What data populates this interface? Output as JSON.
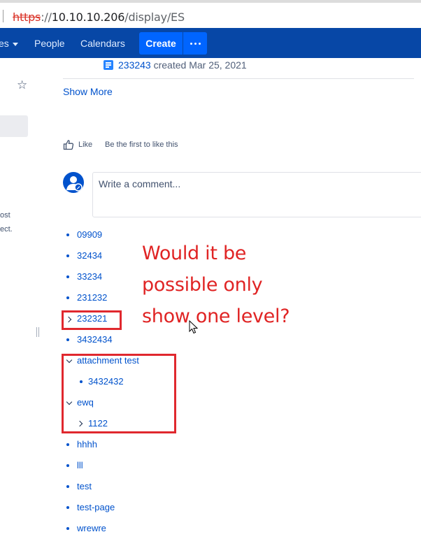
{
  "browser": {
    "url_scheme": "https",
    "url_separator": "://",
    "url_host": "10.10.10.206",
    "url_path": "/display/ES"
  },
  "nav": {
    "spaces_label": "es",
    "people_label": "People",
    "calendars_label": "Calendars",
    "create_label": "Create"
  },
  "sidebar": {
    "text_line1": "ost",
    "text_line2": "ect."
  },
  "content": {
    "page_link": "233243",
    "page_meta": " created Mar 25, 2021",
    "show_more": "Show More",
    "like_label": "Like",
    "like_first": "Be the first to like this",
    "comment_placeholder": "Write a comment..."
  },
  "tree": {
    "items": [
      "09909",
      "32434",
      "33234",
      "231232",
      "232321",
      "3432434",
      "attachment test",
      "3432432",
      "ewq",
      "1122",
      "hhhh",
      "lll",
      "test",
      "test-page",
      "wrewre"
    ]
  },
  "annotation": {
    "line1": "Would it be",
    "line2": "possible only",
    "line3": "show one level?"
  },
  "colors": {
    "nav_bg": "#0747a6",
    "create_bg": "#0065ff",
    "link": "#0052cc",
    "annotation_red": "#e02424"
  }
}
